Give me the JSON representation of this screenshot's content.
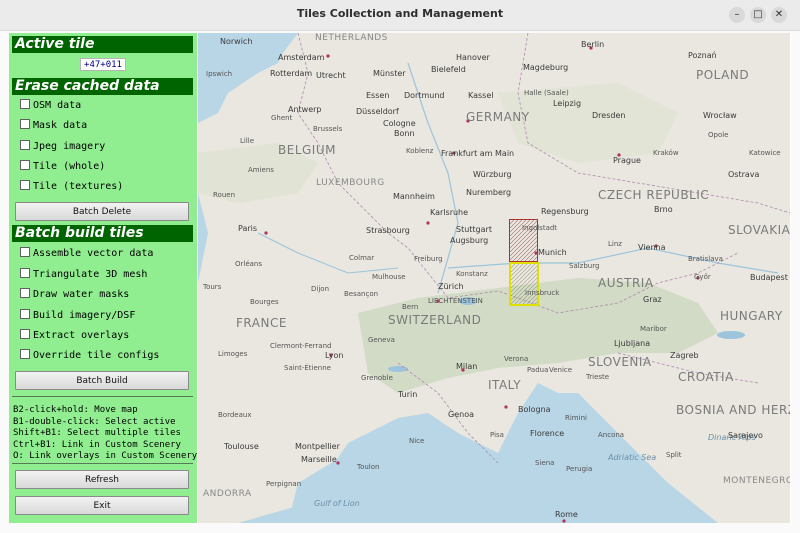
{
  "window": {
    "title": "Tiles Collection and Management",
    "controls": [
      "–",
      "□",
      "✕"
    ]
  },
  "sidebar": {
    "active_tile": {
      "heading": "Active tile",
      "value": "+47+011"
    },
    "erase": {
      "heading": "Erase cached data",
      "options": [
        "OSM data",
        "Mask data",
        "Jpeg imagery",
        "Tile (whole)",
        "Tile (textures)"
      ],
      "button": "Batch Delete"
    },
    "build": {
      "heading": "Batch build tiles",
      "options": [
        "Assemble vector data",
        "Triangulate 3D mesh",
        "Draw water masks",
        "Build imagery/DSF",
        "Extract overlays",
        "Override tile configs"
      ],
      "button": "Batch Build"
    },
    "help": [
      "B2-click+hold: Move map",
      "B1-double-click: Select active",
      "Shift+B1: Select multiple tiles",
      "Ctrl+B1: Link in Custom Scenery",
      "O: Link overlays in Custom Scenery"
    ],
    "refresh_button": "Refresh",
    "exit_button": "Exit"
  },
  "map": {
    "colors": {
      "land": "#e9e7df",
      "water": "#b9d6e6",
      "alps": "#cfd9c3",
      "active_border": "#e0e000",
      "selected_border": "#b03030"
    },
    "countries": [
      "NETHERLANDS",
      "GERMANY",
      "BELGIUM",
      "LUXEMBOURG",
      "CZECH REPUBLIC",
      "POLAND",
      "SLOVAKIA",
      "FRANCE",
      "SWITZERLAND",
      "LIECHTENSTEIN",
      "AUSTRIA",
      "HUNGARY",
      "SLOVENIA",
      "CROATIA",
      "ITALY",
      "BOSNIA AND HERZEGOVINA",
      "MONTENEGRO",
      "ANDORRA"
    ],
    "seas": [
      "Gulf of Lion",
      "Adriatic Sea",
      "Dinaric Alps"
    ],
    "cities": [
      "Norwich",
      "Amsterdam",
      "Hanover",
      "Berlin",
      "Rotterdam",
      "Utrecht",
      "Münster",
      "Bielefeld",
      "Magdeburg",
      "Poznań",
      "Ipswich",
      "Essen",
      "Dortmund",
      "Kassel",
      "Halle (Saale)",
      "Leipzig",
      "Antwerp",
      "Düsseldorf",
      "Cologne",
      "Dresden",
      "Wrocław",
      "Brussels",
      "Bonn",
      "Ghent",
      "Lille",
      "Koblenz",
      "Frankfurt am Main",
      "Prague",
      "Opole",
      "Katowice",
      "Kraków",
      "Würzburg",
      "Nuremberg",
      "Ostrava",
      "Mannheim",
      "Karlsruhe",
      "Stuttgart",
      "Regensburg",
      "Brno",
      "Rouen",
      "Amiens",
      "Paris",
      "Strasbourg",
      "Augsburg",
      "Ingolstadt",
      "Munich",
      "Linz",
      "Vienna",
      "Bratislava",
      "Budapest",
      "Orléans",
      "Colmar",
      "Mulhouse",
      "Freiburg",
      "Konstanz",
      "Zürich",
      "Innsbruck",
      "Salzburg",
      "Graz",
      "Győr",
      "Tours",
      "Dijon",
      "Besançon",
      "Bern",
      "Maribor",
      "Zagreb",
      "Ljubljana",
      "Bourges",
      "Limoges",
      "Lyon",
      "Geneva",
      "Milan",
      "Verona",
      "Venice",
      "Padua",
      "Trieste",
      "Clermont-Ferrand",
      "Saint-Étienne",
      "Grenoble",
      "Turin",
      "Genoa",
      "Bologna",
      "Florence",
      "Rimini",
      "Split",
      "Sarajevo",
      "Bordeaux",
      "Toulouse",
      "Montpellier",
      "Marseille",
      "Nice",
      "Toulon",
      "Perpignan",
      "Pisa",
      "Siena",
      "Perugia",
      "Ancona",
      "Rome"
    ],
    "tiles": {
      "active": "+47+011",
      "selected": [
        "+48+011"
      ]
    }
  }
}
